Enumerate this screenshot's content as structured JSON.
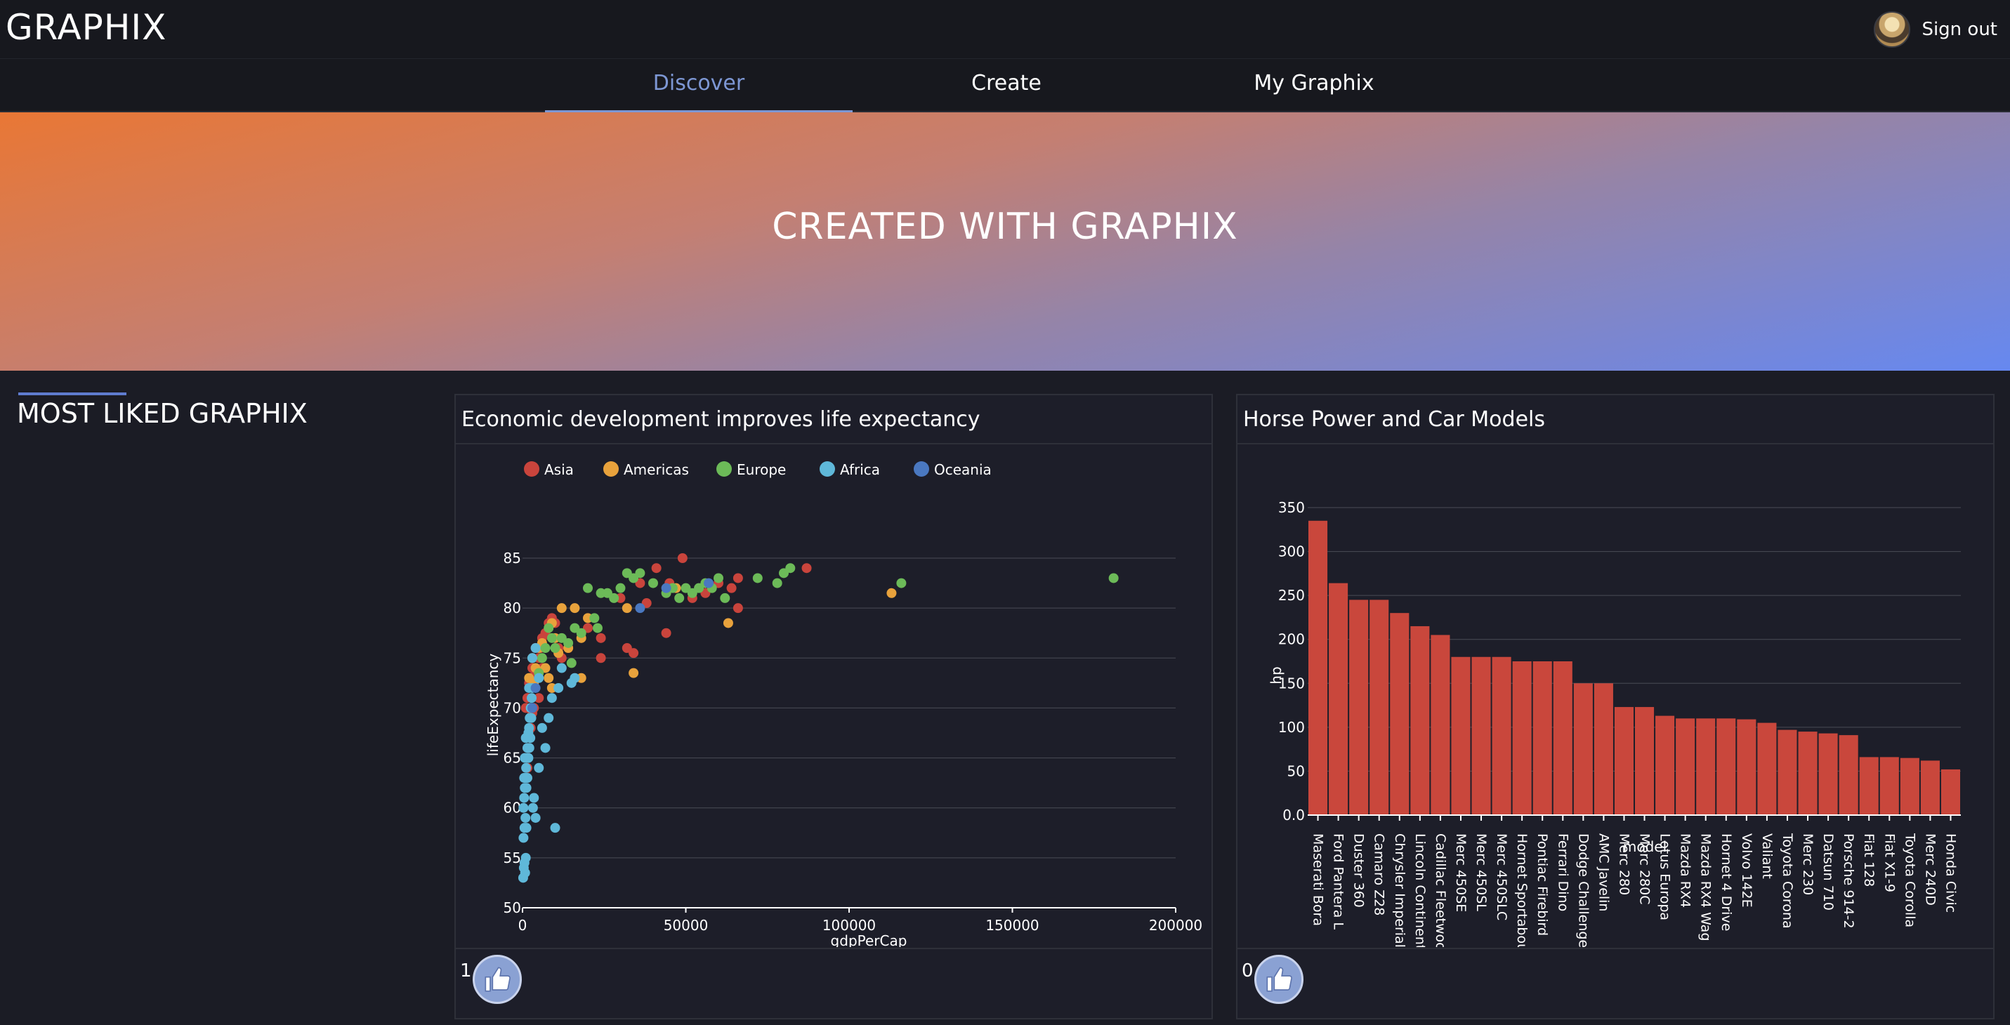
{
  "app": {
    "brand": "GRAPHIX",
    "sign_out": "Sign out"
  },
  "nav": {
    "tabs": [
      {
        "label": "Discover"
      },
      {
        "label": "Create"
      },
      {
        "label": "My Graphix"
      }
    ]
  },
  "hero": {
    "title": "CREATED WITH GRAPHIX"
  },
  "section": {
    "title": "MOST LIKED GRAPHIX"
  },
  "cards": [
    {
      "title": "Economic development improves life expectancy",
      "likes": "1"
    },
    {
      "title": "Horse Power and Car Models",
      "likes": "0"
    }
  ],
  "chart_data": [
    {
      "type": "scatter",
      "title": "Economic development improves life expectancy",
      "xlabel": "gdpPerCap",
      "ylabel": "lifeExpectancy",
      "xlim": [
        0,
        200000
      ],
      "ylim": [
        50,
        85
      ],
      "xticks": [
        "0",
        "50000",
        "100000",
        "150000",
        "200000"
      ],
      "yticks": [
        "50",
        "55",
        "60",
        "65",
        "70",
        "75",
        "80",
        "85"
      ],
      "grid": true,
      "legend_position": "top",
      "series": [
        {
          "name": "Asia",
          "color": "#c9443c",
          "points": [
            [
              1000,
              70
            ],
            [
              1500,
              71
            ],
            [
              2000,
              72.5
            ],
            [
              2500,
              73
            ],
            [
              3000,
              74
            ],
            [
              3500,
              70
            ],
            [
              4000,
              73.5
            ],
            [
              5000,
              75
            ],
            [
              5500,
              76
            ],
            [
              6000,
              77
            ],
            [
              7000,
              77.5
            ],
            [
              8000,
              78.5
            ],
            [
              9000,
              79
            ],
            [
              10000,
              78.5
            ],
            [
              11000,
              76
            ],
            [
              12000,
              75
            ],
            [
              14000,
              76
            ],
            [
              20000,
              78
            ],
            [
              24000,
              77
            ],
            [
              24000,
              75
            ],
            [
              30000,
              81
            ],
            [
              32000,
              76
            ],
            [
              34000,
              75.5
            ],
            [
              36000,
              82.5
            ],
            [
              38000,
              80.5
            ],
            [
              41000,
              84
            ],
            [
              45000,
              82.5
            ],
            [
              49000,
              85
            ],
            [
              52000,
              81
            ],
            [
              56000,
              81.5
            ],
            [
              60000,
              82.5
            ],
            [
              64000,
              82
            ],
            [
              66000,
              83
            ],
            [
              66000,
              80
            ],
            [
              87000,
              84
            ],
            [
              2000,
              66
            ],
            [
              2500,
              68
            ],
            [
              1500,
              64
            ],
            [
              3000,
              69.5
            ],
            [
              5000,
              71
            ],
            [
              44000,
              77.5
            ],
            [
              4000,
              76
            ],
            [
              6000,
              74
            ]
          ]
        },
        {
          "name": "Americas",
          "color": "#e8a23c",
          "points": [
            [
              2000,
              73
            ],
            [
              3000,
              75
            ],
            [
              4000,
              74
            ],
            [
              5000,
              76
            ],
            [
              6000,
              76.5
            ],
            [
              7000,
              74
            ],
            [
              8000,
              73
            ],
            [
              9000,
              78.5
            ],
            [
              10000,
              77
            ],
            [
              12000,
              80
            ],
            [
              14000,
              76
            ],
            [
              16000,
              80
            ],
            [
              18000,
              77
            ],
            [
              20000,
              79
            ],
            [
              32000,
              80
            ],
            [
              34000,
              73.5
            ],
            [
              47000,
              82
            ],
            [
              63000,
              78.5
            ],
            [
              113000,
              81.5
            ],
            [
              9000,
              72
            ],
            [
              11000,
              75.5
            ],
            [
              3500,
              72.5
            ],
            [
              18000,
              73
            ]
          ]
        },
        {
          "name": "Europe",
          "color": "#6cba58",
          "points": [
            [
              6000,
              75
            ],
            [
              8000,
              78
            ],
            [
              10000,
              76
            ],
            [
              12000,
              77
            ],
            [
              14000,
              76.5
            ],
            [
              16000,
              78
            ],
            [
              18000,
              77.5
            ],
            [
              20000,
              82
            ],
            [
              22000,
              79
            ],
            [
              24000,
              81.5
            ],
            [
              26000,
              81.5
            ],
            [
              28000,
              81
            ],
            [
              30000,
              82
            ],
            [
              32000,
              83.5
            ],
            [
              34000,
              83
            ],
            [
              36000,
              83.5
            ],
            [
              40000,
              82.5
            ],
            [
              44000,
              81.5
            ],
            [
              46000,
              82
            ],
            [
              48000,
              81
            ],
            [
              50000,
              82
            ],
            [
              52000,
              81.5
            ],
            [
              54000,
              82
            ],
            [
              56000,
              82.5
            ],
            [
              58000,
              82
            ],
            [
              60000,
              83
            ],
            [
              62000,
              81
            ],
            [
              72000,
              83
            ],
            [
              78000,
              82.5
            ],
            [
              80000,
              83.5
            ],
            [
              82000,
              84
            ],
            [
              116000,
              82.5
            ],
            [
              181000,
              83
            ],
            [
              7000,
              76
            ],
            [
              9000,
              77
            ],
            [
              15000,
              74.5
            ],
            [
              5000,
              73.5
            ],
            [
              23000,
              78
            ]
          ]
        },
        {
          "name": "Africa",
          "color": "#5fb8d9",
          "points": [
            [
              200,
              53
            ],
            [
              400,
              54
            ],
            [
              600,
              54.5
            ],
            [
              800,
              53.5
            ],
            [
              1000,
              55
            ],
            [
              1200,
              58
            ],
            [
              300,
              60
            ],
            [
              500,
              61
            ],
            [
              700,
              62
            ],
            [
              900,
              63
            ],
            [
              1100,
              64
            ],
            [
              1300,
              65
            ],
            [
              1500,
              66
            ],
            [
              1800,
              67.5
            ],
            [
              2000,
              68
            ],
            [
              2200,
              69
            ],
            [
              2500,
              70
            ],
            [
              2800,
              71
            ],
            [
              3000,
              72
            ],
            [
              3200,
              60
            ],
            [
              3500,
              61
            ],
            [
              4000,
              59
            ],
            [
              5000,
              64
            ],
            [
              6000,
              68
            ],
            [
              7000,
              66
            ],
            [
              8000,
              69
            ],
            [
              9000,
              71
            ],
            [
              10000,
              58
            ],
            [
              11000,
              72
            ],
            [
              12000,
              74
            ],
            [
              15000,
              72.5
            ],
            [
              16000,
              73
            ],
            [
              300,
              57
            ],
            [
              600,
              58
            ],
            [
              900,
              59
            ],
            [
              1200,
              62
            ],
            [
              1500,
              63
            ],
            [
              1800,
              65
            ],
            [
              2100,
              66
            ],
            [
              2400,
              67
            ],
            [
              2700,
              69
            ],
            [
              500,
              63
            ],
            [
              700,
              65
            ],
            [
              1000,
              67
            ],
            [
              2000,
              72
            ],
            [
              3000,
              75
            ],
            [
              4000,
              76
            ],
            [
              5000,
              73
            ]
          ]
        },
        {
          "name": "Oceania",
          "color": "#4a78c0",
          "points": [
            [
              3000,
              70
            ],
            [
              4000,
              72
            ],
            [
              36000,
              80
            ],
            [
              44000,
              82
            ],
            [
              57000,
              82.5
            ]
          ]
        }
      ]
    },
    {
      "type": "bar",
      "title": "Horse Power and Car Models",
      "xlabel": "model",
      "ylabel": "hp",
      "ylim": [
        0,
        350
      ],
      "yticks": [
        "0.0",
        "50",
        "100",
        "150",
        "200",
        "250",
        "300",
        "350"
      ],
      "grid": true,
      "color": "#c9473c",
      "categories": [
        "Maserati Bora",
        "Ford Pantera L",
        "Duster 360",
        "Camaro Z28",
        "Chrysler Imperial",
        "Lincoln Continental",
        "Cadillac Fleetwood",
        "Merc 450SE",
        "Merc 450SL",
        "Merc 450SLC",
        "Hornet Sportabout",
        "Pontiac Firebird",
        "Ferrari Dino",
        "Dodge Challenger",
        "AMC Javelin",
        "Merc 280",
        "Merc 280C",
        "Lotus Europa",
        "Mazda RX4",
        "Mazda RX4 Wag",
        "Hornet 4 Drive",
        "Volvo 142E",
        "Valiant",
        "Toyota Corona",
        "Merc 230",
        "Datsun 710",
        "Porsche 914-2",
        "Fiat 128",
        "Fiat X1-9",
        "Toyota Corolla",
        "Merc 240D",
        "Honda Civic"
      ],
      "tick_labels": [
        "Maserati Bora",
        "Ford Pantera L",
        "Duster 360",
        "Camaro Z28",
        "Chrysler Imperial",
        "Lincoln Continenta",
        "Cadillac Fleetwooc",
        "Merc 450SE",
        "Merc 450SL",
        "Merc 450SLC",
        "Hornet Sportabou",
        "Pontiac Firebird",
        "Ferrari Dino",
        "Dodge Challenger",
        "AMC Javelin",
        "Merc 280",
        "Merc 280C",
        "Lotus Europa",
        "Mazda RX4",
        "Mazda RX4 Wag",
        "Hornet 4 Drive",
        "Volvo 142E",
        "Valiant",
        "Toyota Corona",
        "Merc 230",
        "Datsun 710",
        "Porsche 914-2",
        "Fiat 128",
        "Fiat X1-9",
        "Toyota Corolla",
        "Merc 240D",
        "Honda Civic"
      ],
      "values": [
        335,
        264,
        245,
        245,
        230,
        215,
        205,
        180,
        180,
        180,
        175,
        175,
        175,
        150,
        150,
        123,
        123,
        113,
        110,
        110,
        110,
        109,
        105,
        97,
        95,
        93,
        91,
        66,
        66,
        65,
        62,
        52
      ]
    }
  ]
}
